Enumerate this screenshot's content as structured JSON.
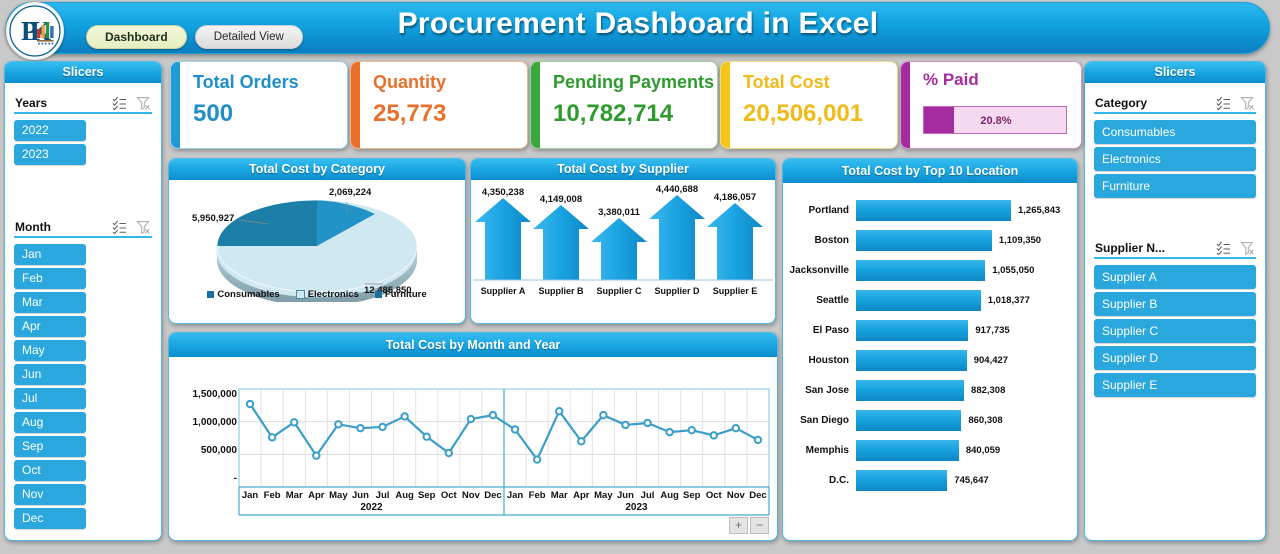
{
  "header": {
    "title": "Procurement Dashboard in Excel",
    "logo_text": "PK",
    "tabs": [
      {
        "label": "Dashboard",
        "active": true
      },
      {
        "label": "Detailed View",
        "active": false
      }
    ]
  },
  "left_slicers": {
    "title": "Slicers",
    "groups": [
      {
        "name": "Years",
        "multiselect_icon": "multi-select-icon",
        "clear_icon": "clear-filter-icon",
        "items": [
          "2022",
          "2023"
        ]
      },
      {
        "name": "Month",
        "multiselect_icon": "multi-select-icon",
        "clear_icon": "clear-filter-icon",
        "items": [
          "Jan",
          "Feb",
          "Mar",
          "Apr",
          "May",
          "Jun",
          "Jul",
          "Aug",
          "Sep",
          "Oct",
          "Nov",
          "Dec"
        ]
      }
    ]
  },
  "right_slicers": {
    "title": "Slicers",
    "groups": [
      {
        "name": "Category",
        "multiselect_icon": "multi-select-icon",
        "clear_icon": "clear-filter-icon",
        "items": [
          "Consumables",
          "Electronics",
          "Furniture"
        ]
      },
      {
        "name": "Supplier N...",
        "multiselect_icon": "multi-select-icon",
        "clear_icon": "clear-filter-icon",
        "items": [
          "Supplier A",
          "Supplier B",
          "Supplier C",
          "Supplier D",
          "Supplier E"
        ]
      }
    ]
  },
  "kpis": [
    {
      "title": "Total Orders",
      "value": "500",
      "color": "#1f9bd6"
    },
    {
      "title": "Quantity",
      "value": "25,773",
      "color": "#e8702a"
    },
    {
      "title": "Pending Payments",
      "value": "10,782,714",
      "color": "#3aa73a"
    },
    {
      "title": "Total Cost",
      "value": "20,506,001",
      "color": "#f5c518"
    },
    {
      "title": "% Paid",
      "value": "20.8%",
      "color": "#a52ba0",
      "percent": 20.8
    }
  ],
  "chart_data": [
    {
      "type": "pie",
      "title": "Total Cost by Category",
      "categories": [
        "Consumables",
        "Electronics",
        "Furniture"
      ],
      "values": [
        2069224,
        12485850,
        5950927
      ],
      "labels": [
        "2,069,224",
        "12,485,850",
        "5,950,927"
      ],
      "colors": [
        "#1f8ebd",
        "#cde8f2",
        "#1b7fa8"
      ],
      "legend": "bottom"
    },
    {
      "type": "bar",
      "title": "Total Cost by Supplier",
      "categories": [
        "Supplier A",
        "Supplier B",
        "Supplier C",
        "Supplier D",
        "Supplier E"
      ],
      "values": [
        4350238,
        4149008,
        3380011,
        4440688,
        4186057
      ],
      "labels": [
        "4,350,238",
        "4,149,008",
        "3,380,011",
        "4,440,688",
        "4,186,057"
      ],
      "xlabel": "",
      "ylabel": "",
      "grid": false,
      "legend": "none"
    },
    {
      "type": "bar",
      "title": "Total Cost by Top 10 Location",
      "orientation": "horizontal",
      "categories": [
        "Portland",
        "Boston",
        "Jacksonville",
        "Seattle",
        "El Paso",
        "Houston",
        "San Jose",
        "San Diego",
        "Memphis",
        "D.C."
      ],
      "values": [
        1265843,
        1109350,
        1055050,
        1018377,
        917735,
        904427,
        882308,
        860308,
        840059,
        745647
      ],
      "labels": [
        "1,265,843",
        "1,109,350",
        "1,055,050",
        "1,018,377",
        "917,735",
        "904,427",
        "882,308",
        "860,308",
        "840,059",
        "745,647"
      ],
      "xlabel": "",
      "ylabel": "",
      "grid": false,
      "legend": "none"
    },
    {
      "type": "line",
      "title": "Total Cost by Month and Year",
      "xlabel": "",
      "ylabel": "",
      "ylim": [
        0,
        1500000
      ],
      "yticks": [
        "1,500,000",
        "1,000,000",
        "500,000",
        "-"
      ],
      "grid": true,
      "legend": "none",
      "year_groups": [
        "2022",
        "2023"
      ],
      "categories": [
        "Jan",
        "Feb",
        "Mar",
        "Apr",
        "May",
        "Jun",
        "Jul",
        "Aug",
        "Sep",
        "Oct",
        "Nov",
        "Dec",
        "Jan",
        "Feb",
        "Mar",
        "Apr",
        "May",
        "Jun",
        "Jul",
        "Aug",
        "Sep",
        "Oct",
        "Nov",
        "Dec"
      ],
      "values": [
        1270000,
        760000,
        990000,
        480000,
        960000,
        900000,
        920000,
        1080000,
        770000,
        520000,
        1040000,
        1100000,
        880000,
        420000,
        1160000,
        700000,
        1100000,
        950000,
        980000,
        840000,
        870000,
        790000,
        900000,
        720000
      ],
      "drill_buttons": [
        "+",
        "−"
      ]
    }
  ]
}
